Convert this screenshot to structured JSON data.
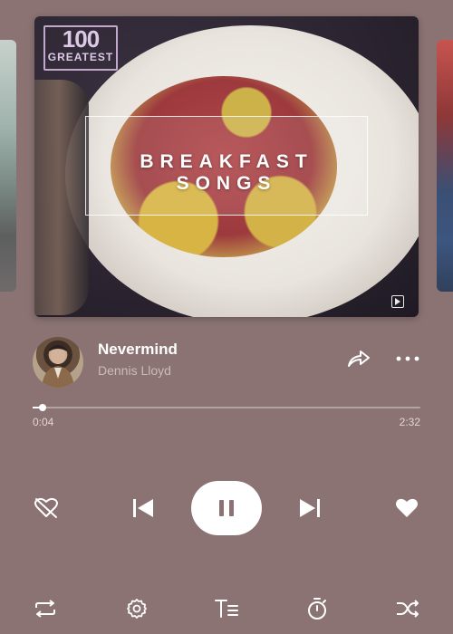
{
  "album": {
    "logo_number": "100",
    "logo_word": "GREATEST",
    "title_line1": "BREAKFAST",
    "title_line2": "SONGS"
  },
  "track": {
    "title": "Nevermind",
    "artist": "Dennis Lloyd"
  },
  "progress": {
    "current": "0:04",
    "total": "2:32",
    "fraction": 0.026
  },
  "icons": {
    "share": "share-icon",
    "more": "more-icon",
    "dislike": "broken-heart-icon",
    "previous": "skip-previous-icon",
    "pause": "pause-icon",
    "next": "skip-next-icon",
    "like": "heart-icon",
    "repeat": "repeat-icon",
    "settings": "settings-icon",
    "lyrics": "lyrics-icon",
    "timer": "timer-icon",
    "shuffle": "shuffle-icon"
  },
  "colors": {
    "background": "#8b7373",
    "accent": "#ffffff"
  }
}
